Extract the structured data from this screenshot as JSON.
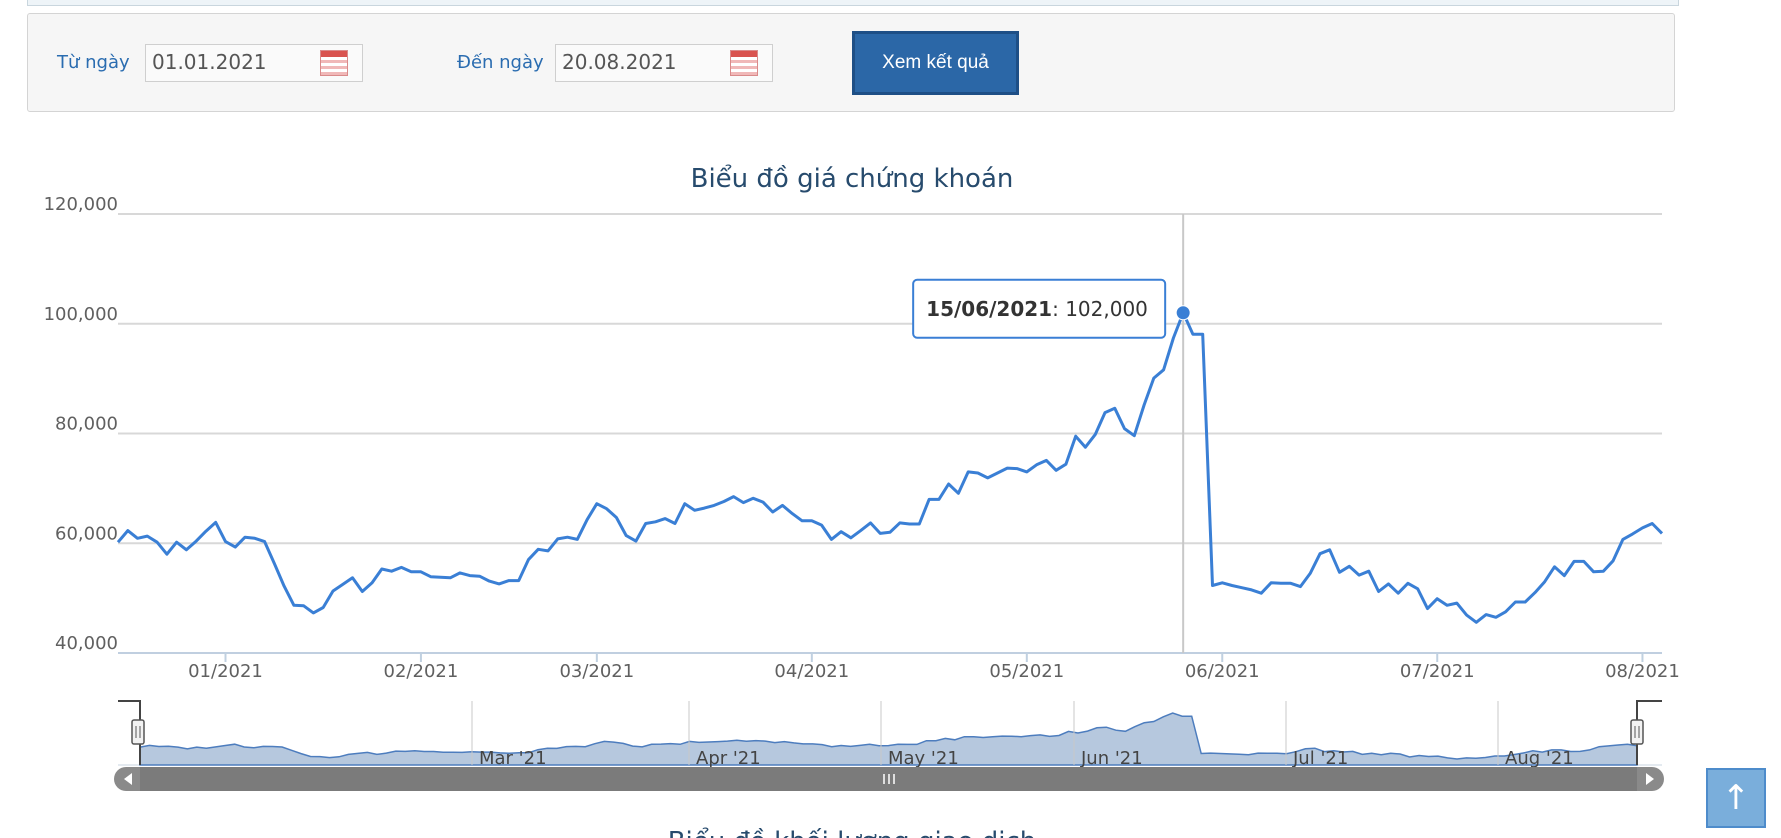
{
  "filter": {
    "from_label": "Từ ngày",
    "from_value": "01.01.2021",
    "to_label": "Đến ngày",
    "to_value": "20.08.2021",
    "submit_label": "Xem kết quả",
    "calendar_icon": "calendar-icon"
  },
  "chart_data": {
    "type": "line",
    "title": "Biểu đồ giá chứng khoán",
    "xlabel": "",
    "ylabel": "",
    "ylim": [
      40000,
      120000
    ],
    "y_ticks": [
      "120,000",
      "100,000",
      "80,000",
      "60,000",
      "40,000"
    ],
    "x_ticks": [
      "01/2021",
      "02/2021",
      "03/2021",
      "04/2021",
      "05/2021",
      "06/2021",
      "07/2021",
      "08/2021"
    ],
    "grid": true,
    "color": "#3a7fd5",
    "tooltip": {
      "date": "15/06/2021",
      "sep": ":",
      "value": "102,000"
    },
    "values": [
      60200,
      62300,
      60900,
      61300,
      60200,
      58000,
      60200,
      58800,
      60400,
      62200,
      63800,
      60300,
      59300,
      61100,
      60900,
      60300,
      56300,
      52200,
      48700,
      48600,
      47300,
      48300,
      51300,
      52500,
      53700,
      51200,
      52800,
      55300,
      54900,
      55600,
      54800,
      54800,
      53900,
      53800,
      53700,
      54600,
      54100,
      54000,
      53100,
      52600,
      53200,
      53200,
      57000,
      58900,
      58600,
      60800,
      61100,
      60700,
      64300,
      67200,
      66300,
      64700,
      61400,
      60400,
      63600,
      63900,
      64500,
      63600,
      67200,
      66000,
      66400,
      66900,
      67600,
      68500,
      67400,
      68200,
      67500,
      65700,
      66900,
      65400,
      64100,
      64100,
      63300,
      60700,
      62100,
      61000,
      62300,
      63700,
      61800,
      62000,
      63700,
      63500,
      63500,
      68000,
      68000,
      70800,
      69100,
      73000,
      72800,
      71900,
      72800,
      73700,
      73600,
      73000,
      74300,
      75100,
      73300,
      74400,
      79500,
      77500,
      79800,
      83800,
      84600,
      80900,
      79600,
      85200,
      90100,
      91600,
      97400,
      102000,
      98100,
      98100,
      52300,
      52800,
      52300,
      51900,
      51500,
      50900,
      52800,
      52700,
      52700,
      52100,
      54500,
      58100,
      58800,
      54700,
      55800,
      54200,
      54900,
      51200,
      52600,
      50900,
      52700,
      51700,
      48100,
      49900,
      48700,
      49100,
      46900,
      45600,
      47000,
      46500,
      47500,
      49300,
      49300,
      51000,
      53000,
      55700,
      54100,
      56700,
      56700,
      54800,
      54900,
      56800,
      60700,
      61700,
      62800,
      63600,
      61800
    ],
    "navigator": {
      "labels": [
        "Mar '21",
        "Apr '21",
        "May '21",
        "Jun '21",
        "Jul '21",
        "Aug '21"
      ],
      "scrollbar_icon": "grip-icon"
    }
  },
  "next_section_title": "Biểu đồ khối lượng giao dịch",
  "back_to_top_icon": "arrow-up-icon"
}
